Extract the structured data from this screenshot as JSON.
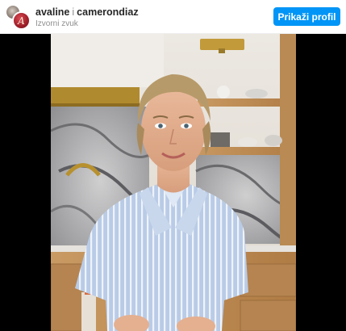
{
  "header": {
    "usernames": [
      "avaline",
      "camerondiaz"
    ],
    "separator": "i",
    "audio_label": "Izvorni zvuk",
    "avatar_letter": "A",
    "profile_button_label": "Prikaži profil"
  },
  "media": {
    "type": "video-still",
    "description_icon": "photo-frame-icon"
  },
  "colors": {
    "accent": "#0095f6",
    "media_background": "#000000"
  }
}
